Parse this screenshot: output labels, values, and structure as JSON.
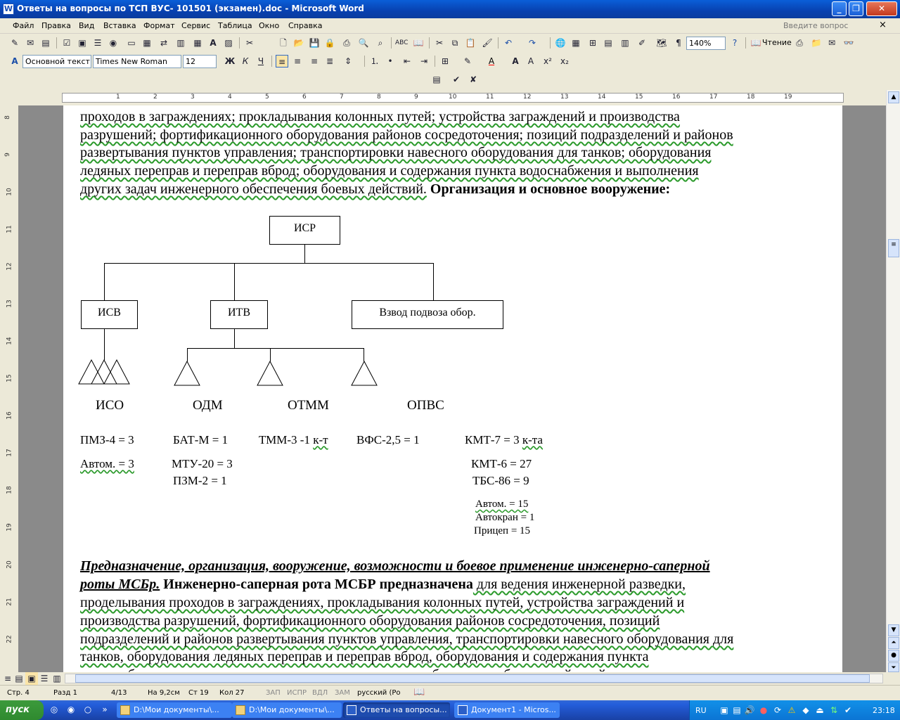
{
  "window": {
    "title": "Ответы на вопросы по ТСП ВУС- 101501 (экзамен).doc - Microsoft Word",
    "app_icon": "W"
  },
  "menu": {
    "items": [
      "Файл",
      "Правка",
      "Вид",
      "Вставка",
      "Формат",
      "Сервис",
      "Таблица",
      "Окно",
      "Справка"
    ],
    "help_placeholder": "Введите вопрос",
    "close": "×"
  },
  "toolbar": {
    "zoom": "140%",
    "read_label": "Чтение",
    "style": "Основной текст",
    "font": "Times New Roman",
    "size": "12"
  },
  "ruler": {
    "h_numbers": [
      "1",
      "2",
      "3",
      "4",
      "5",
      "6",
      "7",
      "8",
      "9",
      "10",
      "11",
      "12",
      "13",
      "14",
      "15",
      "16",
      "17",
      "18",
      "19"
    ],
    "v_numbers": [
      "8",
      "9",
      "10",
      "11",
      "12",
      "13",
      "14",
      "15",
      "16",
      "17",
      "18",
      "19",
      "20",
      "21",
      "22"
    ]
  },
  "document": {
    "para1_lines": [
      "проходов в заграждениях; прокладывания колонных путей; устройства заграждений и производства",
      "разрушений; фортификационного оборудования районов сосредоточения; позиций подразделений и районов",
      "развертывания пунктов управления; транспортировки навесного оборудования для танков; оборудования",
      "ледяных переправ и переправ вброд; оборудования и содержания пункта водоснабжения и выполнения"
    ],
    "para1_last": "других задач инженерного обеспечения боевых действий.",
    "para1_bold": "Организация и основное вооружение:",
    "diagram": {
      "root": "ИСР",
      "isv": "ИСВ",
      "itv": "ИТВ",
      "transport": "Взвод подвоза обор.",
      "iso": "ИСО",
      "odm": "ОДМ",
      "otmm": "ОТММ",
      "opvs": "ОПВС"
    },
    "equipment": {
      "c1r1": "ПМЗ-4 = 3",
      "c1r2": "Автом. = 3",
      "c2r1": "БАТ-М =  1",
      "c2r2": "МТУ-20 = 3",
      "c2r3": "ПЗМ-2 =  1",
      "c3r1a": "ТММ-3 -1 ",
      "c3r1b": "к-т",
      "c4r1": "ВФС-2,5 = 1",
      "c5r1a": "КМТ-7 =  3 ",
      "c5r1b": "к-та",
      "c5r2": "КМТ-6 = 27",
      "c5r3": "ТБС-86 =  9",
      "c5r4": "Автом. = 15",
      "c5r5": "Автокран = 1",
      "c5r6": "Прицеп = 15"
    },
    "para2_head1": "Предназначение, организация, вооружение, возможности и боевое применение инженерно-саперной",
    "para2_head2": "роты МСБр.",
    "para2_bold": " Инженерно-саперная рота МСБР предназначена",
    "para2_rest1": " для ведения инженерной разведки,",
    "para2_lines": [
      "проделывания проходов в заграждениях, прокладывания колонных путей, устройства заграждений и",
      "производства разрушений, фортификационного оборудования районов сосредоточения, позиций",
      "подразделений и районов развертывания пунктов управления, транспортировки навесного оборудования для",
      "танков, оборудования ледяных переправ и переправ вброд, оборудования и содержания пункта",
      "водоснабжения и выполнения других задач инженерного обеспечения боевых действий."
    ]
  },
  "status": {
    "page": "Стр. 4",
    "section": "Разд 1",
    "pages": "4/13",
    "at": "На 9,2см",
    "line": "Ст 19",
    "col": "Кол 27",
    "rec": "ЗАП",
    "trk": "ИСПР",
    "ext": "ВДЛ",
    "ovr": "ЗАМ",
    "lang": "русский (Ро"
  },
  "taskbar": {
    "start": "пуск",
    "tasks": [
      "D:\\Мои документы\\...",
      "D:\\Мои документы\\...",
      "Ответы на вопросы...",
      "Документ1 - Micros..."
    ],
    "lang": "RU",
    "time": "23:18"
  },
  "colors": {
    "title_blue": "#0a5fd8",
    "spell_green": "#2b9a2b",
    "taskbar_blue": "#245edb",
    "start_green": "#3c9a3c"
  }
}
